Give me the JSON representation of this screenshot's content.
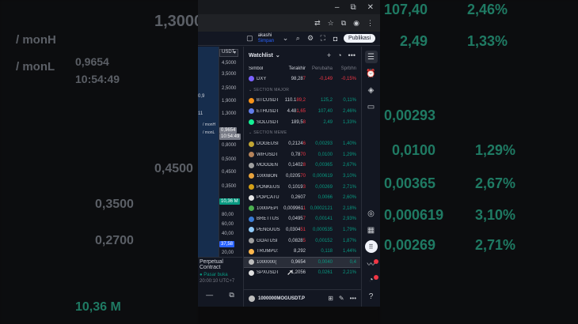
{
  "backdrop_left": [
    {
      "text": "1,3000"
    },
    {
      "text": "/ monH"
    },
    {
      "text": "/ monL"
    },
    {
      "text": "0,9654"
    },
    {
      "text": "10:54:49"
    },
    {
      "text": "0,4500"
    },
    {
      "text": "0,3500"
    },
    {
      "text": "0,2700"
    },
    {
      "text": "10,36 M"
    }
  ],
  "backdrop_right": [
    {
      "text": "107,40"
    },
    {
      "text": "2,46%"
    },
    {
      "text": "2,49"
    },
    {
      "text": "1,33%"
    },
    {
      "text": "0,00293"
    },
    {
      "text": "0,0100"
    },
    {
      "text": "1,29%"
    },
    {
      "text": "0,00365"
    },
    {
      "text": "2,67%"
    },
    {
      "text": "0,000619"
    },
    {
      "text": "3,10%"
    },
    {
      "text": "0,00269"
    },
    {
      "text": "2,71%"
    }
  ],
  "window": {
    "minimize": "–",
    "restore": "⧉",
    "close": "✕"
  },
  "toolbar": {
    "user_name": "akashi",
    "user_subtitle": "Simpan",
    "publish_label": "Publikasi"
  },
  "chart": {
    "ticker_select": "USDT",
    "ticks": [
      "4,5000",
      "3,5000",
      "2,5000",
      "1,9000",
      "1,3000",
      "0,8000",
      "0,5000",
      "0,4500",
      "0,3500",
      "0,2700"
    ],
    "price_tag": "0,9654",
    "price_time": "10:54:49",
    "label_monh": "/ monH",
    "label_monl": "/ monL",
    "left_m1": "0,9",
    "left_m2": "11",
    "vol_tag": "10,36 M",
    "vol_ticks": [
      "80,00",
      "60,00",
      "40,00",
      "20,00"
    ],
    "vol_tag2": "37,58"
  },
  "perpetual": {
    "title": "Perpetual Contract",
    "status": "Pasar buka",
    "datetime": "20:00:10 UTC+7"
  },
  "watchlist": {
    "title": "Watchlist",
    "columns": {
      "symbol": "Simbol",
      "last": "Terakhir",
      "change": "Perubaha",
      "pct": "Sprbhn"
    },
    "top_rows": [
      {
        "sym": "DXY",
        "last": "98,28",
        "lastx": "7",
        "chg": "-0,149",
        "pct": "-0,15%",
        "dir": "dn",
        "color": "#7b61ff"
      }
    ],
    "section_major": "SECTION MAJOR",
    "major_rows": [
      {
        "sym": "BTCUSDT",
        "last": "110.1",
        "lastx": "89,2",
        "chg": "125,2",
        "pct": "0,11%",
        "dir": "up",
        "color": "#f7931a"
      },
      {
        "sym": "ETHUSDT",
        "last": "4.48",
        "lastx": "1,65",
        "chg": "107,40",
        "pct": "2,46%",
        "dir": "up",
        "color": "#627eea"
      },
      {
        "sym": "SOLUSDT",
        "last": "189,5",
        "lastx": "8",
        "chg": "2,49",
        "pct": "1,33%",
        "dir": "up",
        "color": "#14f195"
      }
    ],
    "section_meme": "SECTION MEME",
    "meme_rows": [
      {
        "sym": "DOGEUSI",
        "last": "0,2124",
        "lastx": "6",
        "chg": "0,00293",
        "pct": "1,40%",
        "dir": "up",
        "color": "#c2a633"
      },
      {
        "sym": "WIFUSDT",
        "last": "0,78",
        "lastx": "70",
        "chg": "0,0100",
        "pct": "1,29%",
        "dir": "up",
        "color": "#b5835a"
      },
      {
        "sym": "MOODEN",
        "last": "0,1402",
        "lastx": "8",
        "chg": "0,00365",
        "pct": "2,67%",
        "dir": "up",
        "color": "#a0a0a0"
      },
      {
        "sym": "1000BON",
        "last": "0,0205",
        "lastx": "70",
        "chg": "0,000619",
        "pct": "3,10%",
        "dir": "up",
        "color": "#e8a33d"
      },
      {
        "sym": "PONKEUS",
        "last": "0,1019",
        "lastx": "3",
        "chg": "0,00269",
        "pct": "2,71%",
        "dir": "up",
        "color": "#d4a017"
      },
      {
        "sym": "POPCATU",
        "last": "0,2607",
        "lastx": "",
        "chg": "0,0066",
        "pct": "2,60%",
        "dir": "up",
        "color": "#e6e6e6"
      },
      {
        "sym": "1000PEPI",
        "last": "0,009961",
        "lastx": "1",
        "chg": "0,0002121",
        "pct": "2,18%",
        "dir": "up",
        "color": "#4caf50"
      },
      {
        "sym": "BRETTUS",
        "last": "0,0495",
        "lastx": "7",
        "chg": "0,00141",
        "pct": "2,93%",
        "dir": "up",
        "color": "#3a7bd5"
      },
      {
        "sym": "PENGUUS",
        "last": "0,0304",
        "lastx": "51",
        "chg": "0,000535",
        "pct": "1,79%",
        "dir": "up",
        "color": "#90caf9"
      },
      {
        "sym": "GOATUSI",
        "last": "0,0828",
        "lastx": "5",
        "chg": "0,00152",
        "pct": "1,87%",
        "dir": "up",
        "color": "#9e9e9e"
      },
      {
        "sym": "TRUMPU:",
        "last": "8,292",
        "lastx": "",
        "chg": "0,118",
        "pct": "1,44%",
        "dir": "up",
        "color": "#ffb74d"
      },
      {
        "sym": "1000000(",
        "last": "0,9654",
        "lastx": "",
        "chg": "0,0040",
        "pct": "0,4",
        "dir": "up",
        "color": "#bdbdbd"
      },
      {
        "sym": "SPXUSDT",
        "last": "1,2056",
        "lastx": "",
        "chg": "0,0261",
        "pct": "2,21%",
        "dir": "up",
        "color": "#e0e0e0"
      }
    ],
    "footer_symbol": "1000000MOGUSDT.P"
  }
}
